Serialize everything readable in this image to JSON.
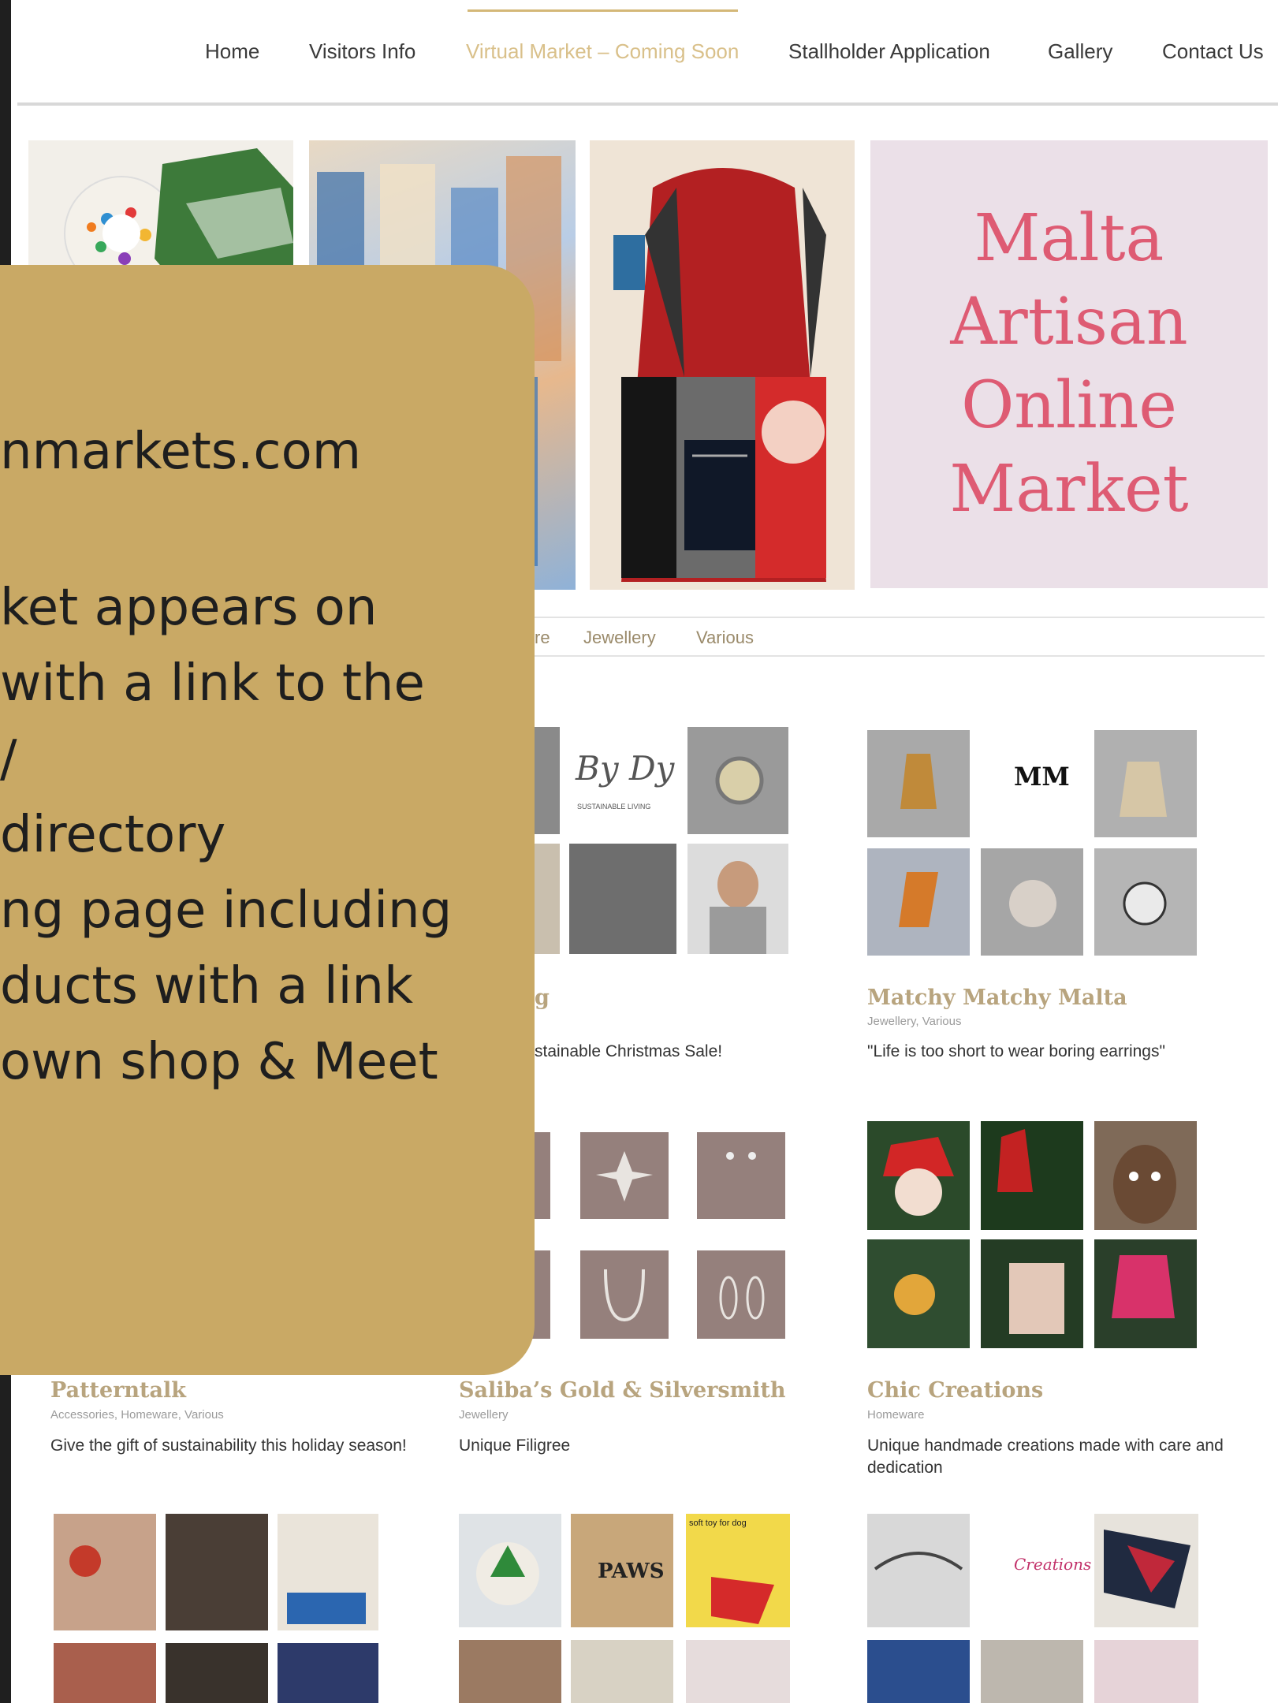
{
  "nav": {
    "items": [
      {
        "label": "Home",
        "active": false
      },
      {
        "label": "Visitors Info",
        "active": false
      },
      {
        "label": "Virtual Market – Coming Soon",
        "active": true
      },
      {
        "label": "Stallholder Application",
        "active": false
      },
      {
        "label": "Gallery",
        "active": false
      },
      {
        "label": "Contact Us",
        "active": false
      }
    ]
  },
  "hero": {
    "title_lines": [
      "Malta",
      "Artisan",
      "Online",
      "Market"
    ]
  },
  "category_tabs": [
    "re",
    "Jewellery",
    "Various"
  ],
  "vendors": [
    {
      "name": "",
      "name_tail": "g",
      "categories": "",
      "tagline": "stainable Christmas Sale!"
    },
    {
      "name": "Matchy Matchy Malta",
      "categories": "Jewellery, Various",
      "tagline": "\"Life is too short to wear boring earrings\""
    },
    {
      "name": "Patterntalk",
      "categories": "Accessories, Homeware, Various",
      "tagline": "Give the gift of sustainability this holiday season!"
    },
    {
      "name": "Saliba’s Gold & Silversmith",
      "categories": "Jewellery",
      "tagline": "Unique Filigree"
    },
    {
      "name": "Chic Creations",
      "categories": "Homeware",
      "tagline": "Unique handmade creations made with care and dedication"
    }
  ],
  "image_labels": {
    "bydy_logo": "By Dy",
    "bydy_sub": "SUSTAINABLE LIVING",
    "mm_logo": "MM",
    "paws": "PAWS",
    "toy_note": "soft toy for dog",
    "creations": "Creations"
  },
  "overlay": {
    "lines": [
      "nmarkets.com",
      "ket appears on",
      "with a link to the",
      "/",
      "directory",
      "ng page including",
      "ducts with a link",
      " own shop & Meet"
    ]
  },
  "colors": {
    "overlay_bg": "#c9a965",
    "brand_pink": "#de5b73",
    "nav_active": "#d9c08a",
    "vendor_name": "#b8a47e"
  }
}
